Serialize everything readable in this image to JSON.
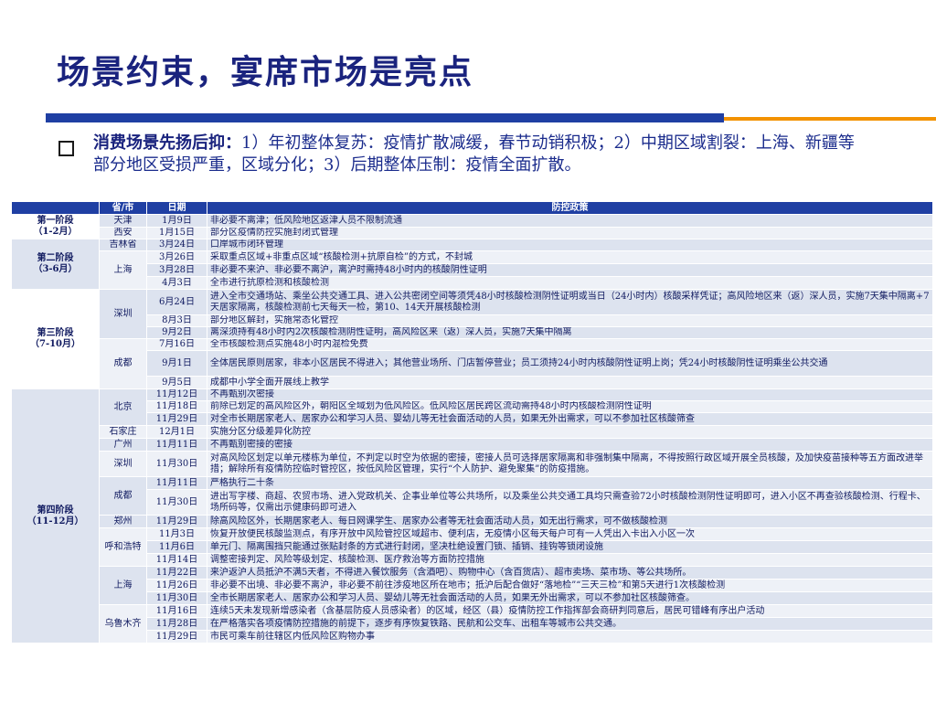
{
  "title": "场景约束，宴席市场是亮点",
  "intro": {
    "lead": "消费场景先扬后抑：",
    "text": "1）年初整体复苏：疫情扩散减缓，春节动销积极；2）中期区域割裂：上海、新疆等部分地区受损严重，区域分化；3）后期整体压制：疫情全面扩散。"
  },
  "table": {
    "headers": [
      "",
      "省/市",
      "日期",
      "防控政策"
    ],
    "stages": [
      {
        "label": "第一阶段\n（1-2月）",
        "rows": [
          {
            "city": "天津",
            "date": "1月9日",
            "policy": "非必要不离津；低风险地区返津人员不限制流通"
          },
          {
            "city": "西安",
            "date": "1月15日",
            "policy": "部分区疫情防控实施封闭式管理"
          }
        ]
      },
      {
        "label": "第二阶段\n（3-6月）",
        "rows": [
          {
            "city": "吉林省",
            "date": "3月24日",
            "policy": "口岸城市闭环管理"
          },
          {
            "city": "上海",
            "date": "3月26日",
            "policy": "采取重点区域+非重点区域“核酸检测+抗原自检”的方式，不封城"
          },
          {
            "city": "",
            "date": "3月28日",
            "policy": "非必要不来沪、非必要不离沪，离沪时需持48小时内的核酸阴性证明"
          },
          {
            "city": "",
            "date": "4月3日",
            "policy": "全市进行抗原检测和核酸检测"
          }
        ]
      },
      {
        "label": "第三阶段\n（7-10月）",
        "rows": [
          {
            "city": "深圳",
            "date": "6月24日",
            "policy": "进入全市交通场站、乘坐公共交通工具、进入公共密闭空间等须凭48小时核酸检测阴性证明或当日（24小时内）核酸采样凭证；高风险地区来（返）深人员，实施7天集中隔离+7天居家隔离，核酸检测前七天每天一检，第10、14天开展核酸检测"
          },
          {
            "city": "",
            "date": "8月3日",
            "policy": "部分地区解封，实施常态化管控"
          },
          {
            "city": "",
            "date": "9月2日",
            "policy": "离深须持有48小时内2次核酸检测阴性证明，高风险区来（返）深人员，实施7天集中隔离"
          },
          {
            "city": "成都",
            "date": "7月16日",
            "policy": "全市核酸检测点实施48小时内混检免费"
          },
          {
            "city": "",
            "date": "9月1日",
            "policy": "全体居民原则居家，非本小区居民不得进入；其他营业场所、门店暂停营业；员工须持24小时内核酸阴性证明上岗；凭24小时核酸阴性证明乘坐公共交通"
          },
          {
            "city": "",
            "date": "9月5日",
            "policy": "成都中小学全面开展线上教学"
          }
        ]
      },
      {
        "label": "第四阶段\n（11-12月）",
        "rows": [
          {
            "city": "北京",
            "date": "11月12日",
            "policy": "不再甄别次密接"
          },
          {
            "city": "",
            "date": "11月18日",
            "policy": "前除已划定的高风险区外，朝阳区全域划为低风险区。低风险区居民跨区流动需持48小时内核酸检测阴性证明"
          },
          {
            "city": "",
            "date": "11月29日",
            "policy": "对全市长期居家老人、居家办公和学习人员、婴幼儿等无社会面活动的人员，如果无外出需求，可以不参加社区核酸筛查"
          },
          {
            "city": "石家庄",
            "date": "12月1日",
            "policy": "实施分区分级差异化防控"
          },
          {
            "city": "广州",
            "date": "11月11日",
            "policy": "不再甄别密接的密接"
          },
          {
            "city": "深圳",
            "date": "11月30日",
            "policy": "对高风险区划定以单元楼栋为单位，不判定以时空为依据的密接，密接人员可选择居家隔离和非强制集中隔离，不得按照行政区域开展全员核酸，及加快疫苗接种等五方面改进举措；解除所有疫情防控临时管控区，按低风险区管理，实行“个人防护、避免聚集”的防疫措施。"
          },
          {
            "city": "成都",
            "date": "11月11日",
            "policy": "严格执行二十条"
          },
          {
            "city": "",
            "date": "11月30日",
            "policy": "进出写字楼、商超、农贸市场、进入党政机关、企事业单位等公共场所，以及乘坐公共交通工具均只需查验72小时核酸检测阴性证明即可，进入小区不再查验核酸检测、行程卡、场所码等，仅需出示健康码即可进入"
          },
          {
            "city": "郑州",
            "date": "11月29日",
            "policy": "除高风险区外，长期居家老人、每日网课学生、居家办公者等无社会面活动人员，如无出行需求，可不做核酸检测"
          },
          {
            "city": "呼和浩特",
            "date": "11月3日",
            "policy": "恢复开放便民核酸监测点，有序开放中风险管控区域超市、便利店，无疫情小区每天每户可有一人凭出入卡出入小区一次"
          },
          {
            "city": "",
            "date": "11月6日",
            "policy": "单元门、隔离围挡只能通过张贴封条的方式进行封闭，坚决杜绝设置门锁、插销、挂钩等锁闭设施"
          },
          {
            "city": "",
            "date": "11月14日",
            "policy": "调整密接判定、风险等级划定、核酸检测、医疗救治等方面防控措施"
          },
          {
            "city": "上海",
            "date": "11月22日",
            "policy": "来沪返沪人员抵沪不满5天者，不得进入餐饮服务（含酒吧）、购物中心（含百货店）、超市卖场、菜市场、等公共场所。"
          },
          {
            "city": "",
            "date": "11月26日",
            "policy": "非必要不出境、非必要不离沪，非必要不前往涉疫地区所在地市；抵沪后配合做好“落地检”“三天三检”和第5天进行1次核酸检测"
          },
          {
            "city": "",
            "date": "11月30日",
            "policy": "全市长期居家老人、居家办公和学习人员、婴幼儿等无社会面活动的人员，如果无外出需求，可以不参加社区核酸筛查。"
          },
          {
            "city": "乌鲁木齐",
            "date": "11月16日",
            "policy": "连续5天未发现新增感染者（含基层防疫人员感染者）的区域，经区（县）疫情防控工作指挥部会商研判同意后，居民可错峰有序出户活动"
          },
          {
            "city": "",
            "date": "11月28日",
            "policy": "在严格落实各项疫情防控措施的前提下，逐步有序恢复铁路、民航和公交车、出租车等城市公共交通。"
          },
          {
            "city": "",
            "date": "11月29日",
            "policy": "市民可乘车前往辖区内低风险区购物办事"
          }
        ]
      }
    ]
  }
}
